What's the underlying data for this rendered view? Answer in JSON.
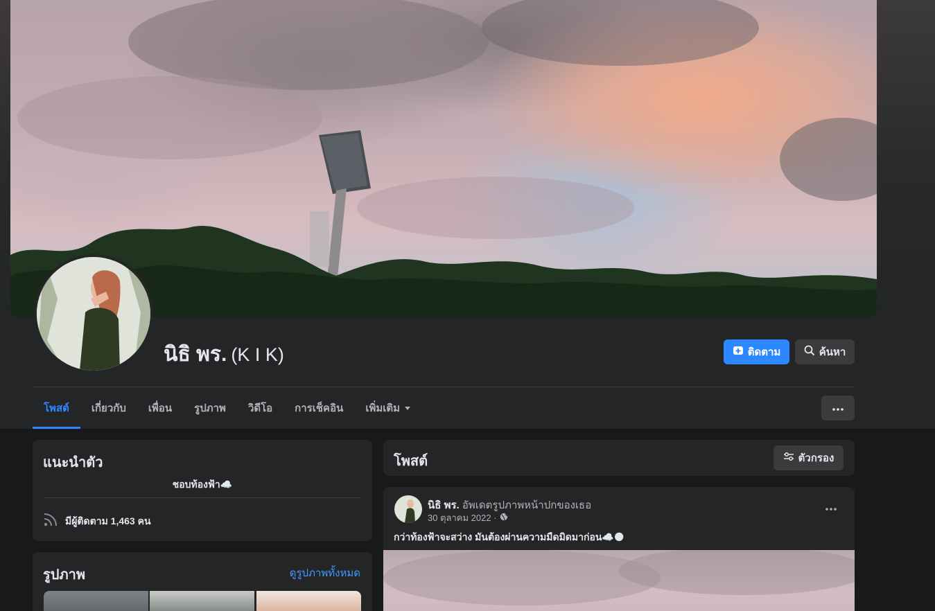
{
  "profile": {
    "name": "นิธิ พร.",
    "alt_name": "(K I K)"
  },
  "actions": {
    "follow_label": "ติดตาม",
    "search_label": "ค้นหา"
  },
  "tabs": [
    {
      "label": "โพสต์",
      "active": true
    },
    {
      "label": "เกี่ยวกับ"
    },
    {
      "label": "เพื่อน"
    },
    {
      "label": "รูปภาพ"
    },
    {
      "label": "วิดีโอ"
    },
    {
      "label": "การเช็คอิน"
    },
    {
      "label": "เพิ่มเติม"
    }
  ],
  "intro": {
    "title": "แนะนำตัว",
    "bio": "ชอบท้องฟ้า☁️",
    "followers": "มีผู้ติดตาม 1,463 คน"
  },
  "photos": {
    "title": "รูปภาพ",
    "see_all": "ดูรูปภาพทั้งหมด"
  },
  "posts": {
    "title": "โพสต์",
    "filter_label": "ตัวกรอง"
  },
  "post": {
    "author": "นิธิ พร.",
    "action": "อัพเดตรูปภาพหน้าปกของเธอ",
    "date": "30 ตุลาคม 2022 ·",
    "text": "กว่าท้องฟ้าจะสว่าง มันต้องผ่านความมืดมิดมาก่อน☁️🌑"
  },
  "colors": {
    "accent": "#2d88ff",
    "link": "#4599ff",
    "card": "#242526",
    "background": "#18191a"
  }
}
